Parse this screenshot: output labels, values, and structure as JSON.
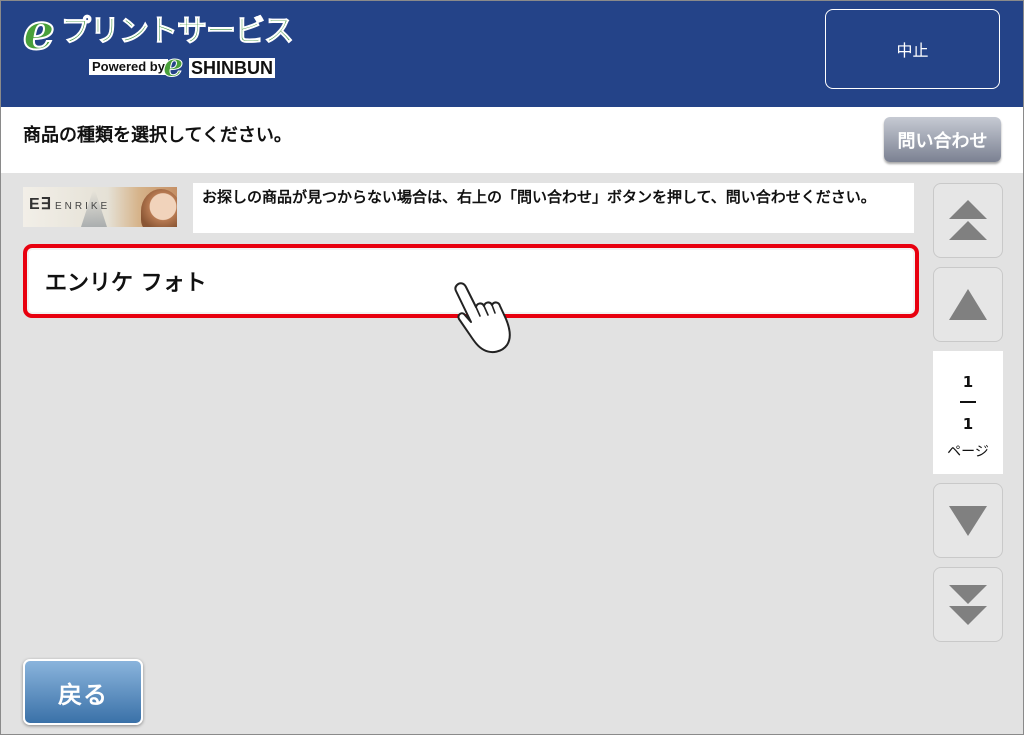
{
  "header": {
    "logo_title": "プリントサービス",
    "logo_powered_by": "Powered by",
    "logo_brand": "SHINBUN",
    "cancel_label": "中止",
    "brand_color": "#244388"
  },
  "instruction": {
    "text": "商品の種類を選択してください。",
    "inquiry_label": "問い合わせ"
  },
  "banner": {
    "logo_text": "ENRIKE",
    "notice": "お探しの商品が見つからない場合は、右上の「問い合わせ」ボタンを押して、問い合わせください。"
  },
  "products": [
    {
      "label": "エンリケ フォト",
      "selected": true
    }
  ],
  "pager": {
    "current": "1",
    "total": "1",
    "unit": "ページ",
    "buttons": [
      "first-page-icon",
      "prev-page-icon",
      "next-page-icon",
      "last-page-icon"
    ]
  },
  "footer": {
    "back_label": "戻る"
  },
  "colors": {
    "selection_border": "#e8000f",
    "logo_green": "#49a03a",
    "back_button": "#3a71a8"
  },
  "icons": {
    "pointer": "pointing-hand-icon"
  }
}
